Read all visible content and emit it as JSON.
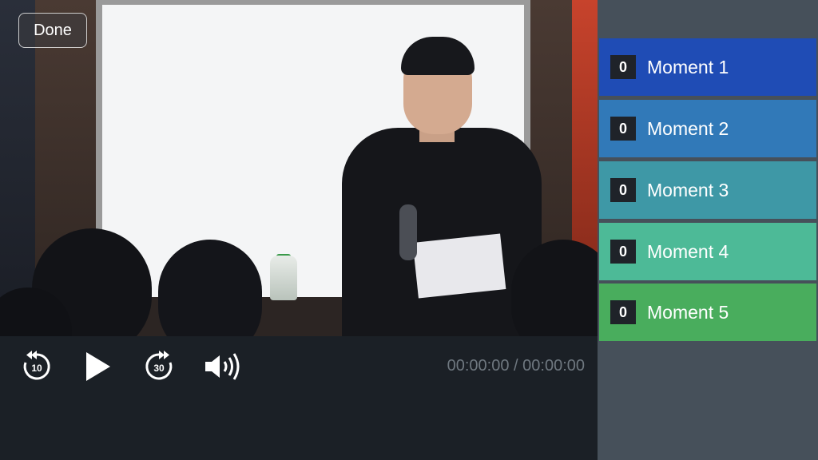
{
  "player": {
    "done_label": "Done",
    "current_time": "00:00:00",
    "separator": "/",
    "duration": "00:00:00",
    "rewind_seconds": "10",
    "forward_seconds": "30"
  },
  "moments": [
    {
      "count": "0",
      "label": "Moment 1",
      "color": "#1f4cb5"
    },
    {
      "count": "0",
      "label": "Moment 2",
      "color": "#3179b8"
    },
    {
      "count": "0",
      "label": "Moment 3",
      "color": "#3e98a6"
    },
    {
      "count": "0",
      "label": "Moment 4",
      "color": "#4dba97"
    },
    {
      "count": "0",
      "label": "Moment 5",
      "color": "#49ad5d"
    }
  ],
  "icons": {
    "rewind": "rewind-10-icon",
    "play": "play-icon",
    "forward": "forward-30-icon",
    "volume": "volume-icon"
  }
}
